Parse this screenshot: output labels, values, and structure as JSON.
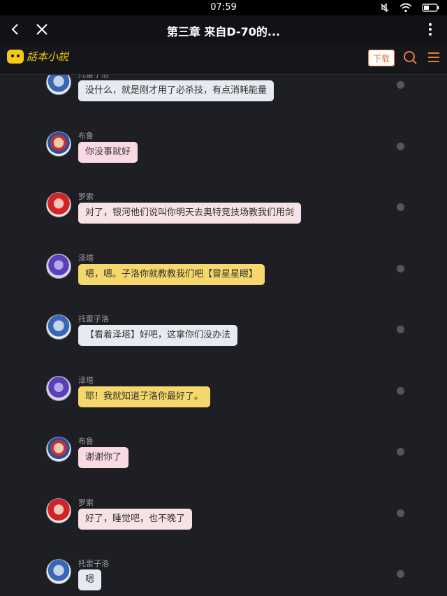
{
  "status_bar": {
    "time": "07:59"
  },
  "header": {
    "title": "第三章 来自D-70的..."
  },
  "appbar": {
    "logo_text": "話本小説",
    "download_label": "下载"
  },
  "messages": [
    {
      "sender": "托雷子洛",
      "text": "没什么，就是刚才用了必杀技，有点消耗能量",
      "bubble_color": "#e7eaf0",
      "avatar": "blue-hero"
    },
    {
      "sender": "布鲁",
      "text": "你没事就好",
      "bubble_color": "#fbd9e3",
      "avatar": "red-blue-hero"
    },
    {
      "sender": "罗索",
      "text": "对了，银河他们说叫你明天去奥特竞技场教我们用剑",
      "bubble_color": "#f7e3e6",
      "avatar": "red-hero"
    },
    {
      "sender": "泽塔",
      "text": "嗯，嗯。子洛你就教教我们吧【冒星星眼】",
      "bubble_color": "#f6d76b",
      "avatar": "purple-hero"
    },
    {
      "sender": "托雷子洛",
      "text": "【看着泽塔】好吧，这拿你们没办法",
      "bubble_color": "#e7eaf0",
      "avatar": "blue-hero"
    },
    {
      "sender": "泽塔",
      "text": "耶！我就知道子洛你最好了。",
      "bubble_color": "#f6d76b",
      "avatar": "purple-hero"
    },
    {
      "sender": "布鲁",
      "text": "谢谢你了",
      "bubble_color": "#fbd9e3",
      "avatar": "red-blue-hero"
    },
    {
      "sender": "罗索",
      "text": "好了，睡觉吧，也不晚了",
      "bubble_color": "#f7e3e6",
      "avatar": "red-hero"
    },
    {
      "sender": "托雷子洛",
      "text": "嗯",
      "bubble_color": "#e7eaf0",
      "avatar": "blue-hero"
    }
  ]
}
